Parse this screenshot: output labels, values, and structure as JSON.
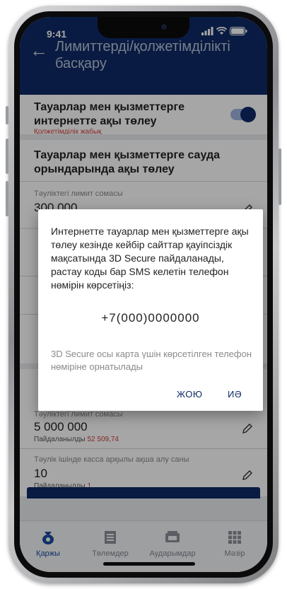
{
  "status_bar": {
    "time": "9:41"
  },
  "header": {
    "title": "Лимиттерді/қолжетімділікті басқару"
  },
  "internet_section": {
    "title": "Тауарлар мен қызметтерге интернетте ақы төлеу",
    "status": "Қолжетімділік жабық",
    "toggle_on": true
  },
  "store_section": {
    "title": "Тауарлар мен қызметтерге сауда орындарында ақы төлеу",
    "limit_label": "Тәуліктегі лимит сомасы",
    "limit_value": "300 000"
  },
  "cash_section": {
    "limit_label": "Тәуліктегі лимит сомасы",
    "limit_value": "5 000 000",
    "used_label": "Пайдаланылды",
    "used_value": "52 509,74",
    "count_label": "Тәулік ішінде касса арқылы ақша алу саны",
    "count_value": "10",
    "count_used_label": "Пайдаланылды",
    "count_used_value": "1"
  },
  "dialog": {
    "message": "Интернетте тауарлар мен қызметтерге ақы төлеу кезінде кейбір сайттар қауіпсіздік мақсатында 3D Secure пайдаланады, растау коды бар SMS келетін телефон нөмірін көрсетіңіз:",
    "phone": "+7(000)0000000",
    "note": "3D Secure осы карта үшін көрсетілген телефон нөміріне орнатылады",
    "cancel_label": "ЖОЮ",
    "ok_label": "ИӘ"
  },
  "nav": [
    {
      "label": "Қаржы",
      "icon": "wallet-icon",
      "active": true
    },
    {
      "label": "Төлемдер",
      "icon": "list-icon",
      "active": false
    },
    {
      "label": "Аударымдар",
      "icon": "card-icon",
      "active": false
    },
    {
      "label": "Мәзір",
      "icon": "grid-icon",
      "active": false
    }
  ],
  "colors": {
    "primary": "#0e2a66",
    "accent_red": "#d23c3c"
  }
}
